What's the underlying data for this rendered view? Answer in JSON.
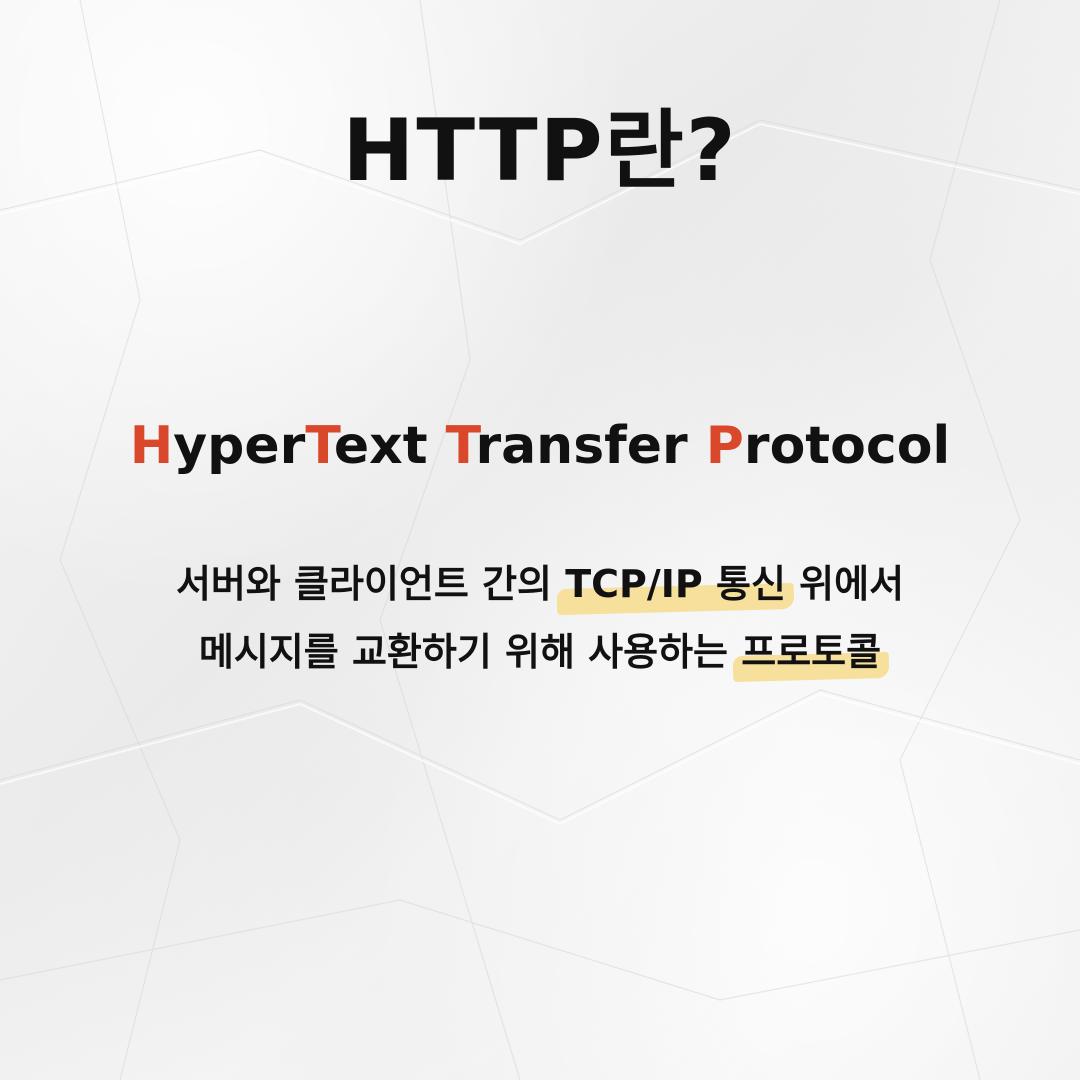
{
  "title": "HTTP란?",
  "acronym": {
    "words": [
      {
        "initial": "H",
        "rest": "yperText"
      },
      {
        "initial": "T",
        "rest": "ext"
      },
      {
        "initial": "T",
        "rest": "ransfer"
      },
      {
        "initial": "P",
        "rest": "rotocol"
      }
    ]
  },
  "description": {
    "line1": {
      "pre": "서버와 클라이언트 간의 ",
      "highlight": "TCP/IP 통신",
      "post": " 위에서"
    },
    "line2": {
      "pre": "메시지를 교환하기 위해 사용하는 ",
      "highlight": "프로토콜",
      "post": ""
    }
  },
  "colors": {
    "text": "#111111",
    "initial_accent": "#d9482b",
    "highlight": "#f6dc8c",
    "paper": "#f1f1f1"
  }
}
